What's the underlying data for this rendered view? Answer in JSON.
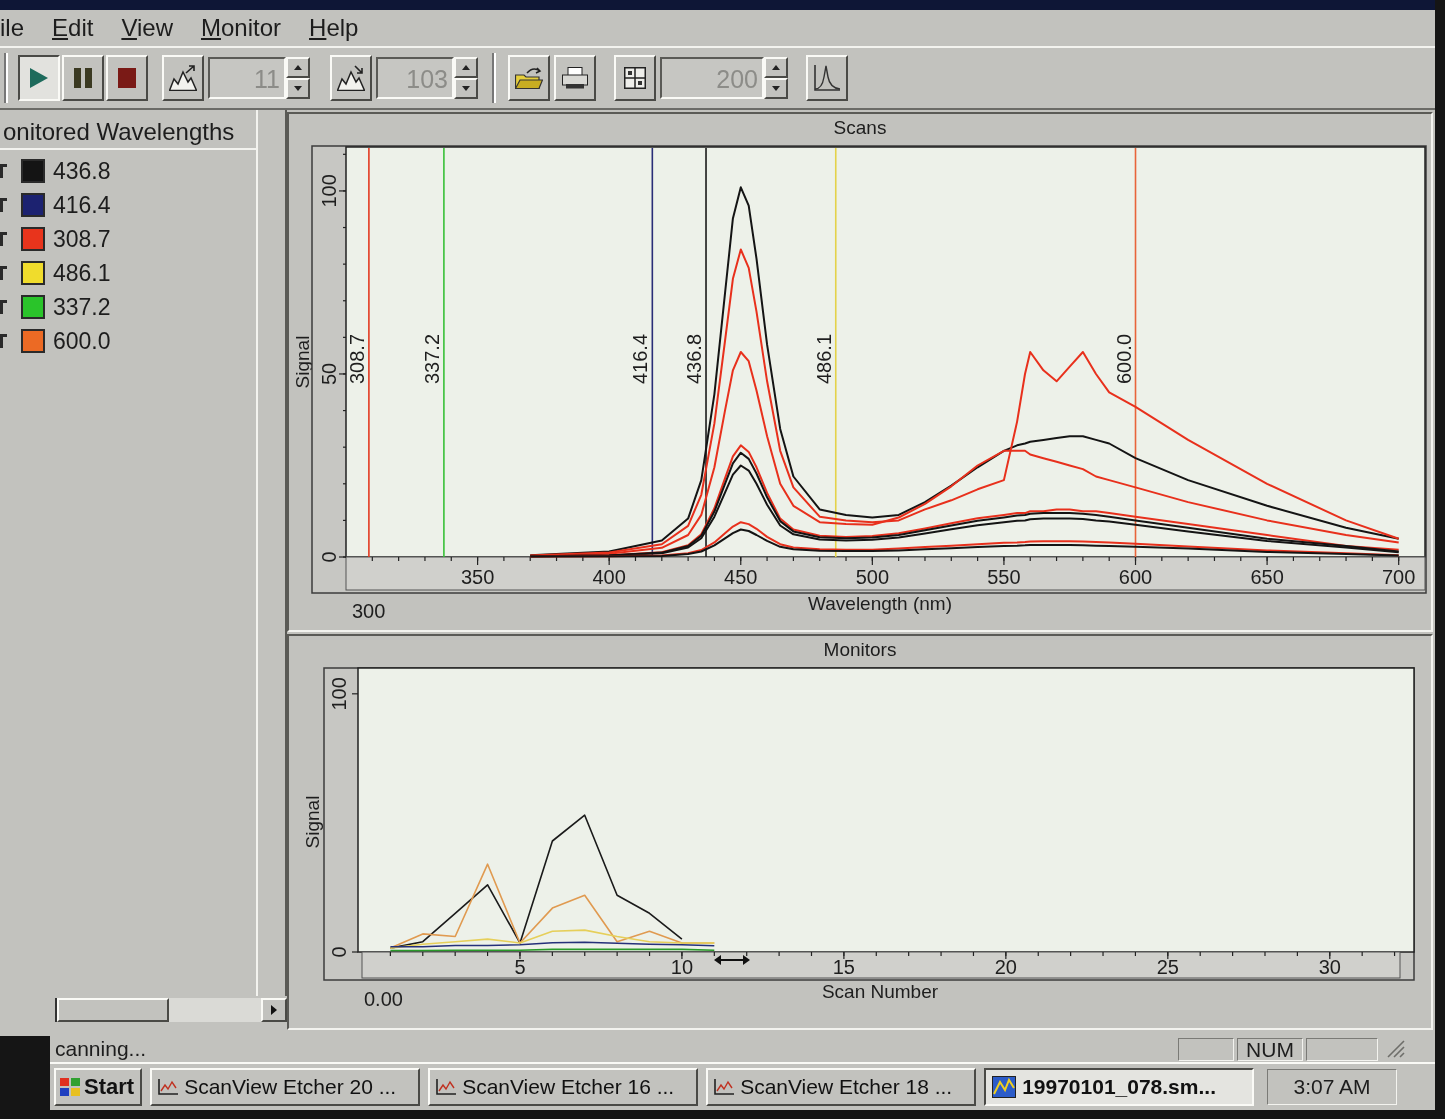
{
  "menu": [
    {
      "label": "ile",
      "underline_first": false
    },
    {
      "label": "Edit",
      "underline_first": true
    },
    {
      "label": "View",
      "underline_first": true
    },
    {
      "label": "Monitor",
      "underline_first": true
    },
    {
      "label": "Help",
      "underline_first": true
    }
  ],
  "toolbar": {
    "transport": [
      {
        "kind": "play",
        "selected": true
      },
      {
        "kind": "pause",
        "selected": false
      },
      {
        "kind": "stop",
        "selected": false
      }
    ],
    "groups": [
      [
        {
          "kind": "peaks-up"
        },
        {
          "kind": "spin",
          "value": "11",
          "disabled": true
        },
        {
          "kind": "peaks-down"
        },
        {
          "kind": "spin",
          "value": "103",
          "disabled": true
        }
      ],
      [
        {
          "kind": "open"
        },
        {
          "kind": "print"
        },
        {
          "kind": "grid"
        },
        {
          "kind": "spin",
          "value": "200",
          "disabled": true
        },
        {
          "kind": "spectrum"
        }
      ]
    ]
  },
  "wavelength_panel": {
    "title": "onitored Wavelengths",
    "items": [
      {
        "label": "436.8",
        "color": "#141414"
      },
      {
        "label": "416.4",
        "color": "#1c2270"
      },
      {
        "label": "308.7",
        "color": "#e8341c"
      },
      {
        "label": "486.1",
        "color": "#f0dc2c"
      },
      {
        "label": "337.2",
        "color": "#2ac42a"
      },
      {
        "label": "600.0",
        "color": "#ec6a24"
      }
    ]
  },
  "scans": {
    "x_start_label": "300",
    "chart_data": {
      "type": "line",
      "title": "Scans",
      "xlabel": "Wavelength (nm)",
      "ylabel": "Signal",
      "x": [
        370,
        400,
        420,
        430,
        435,
        440,
        444,
        447,
        450,
        453,
        456,
        460,
        465,
        470,
        480,
        490,
        500,
        510,
        520,
        530,
        540,
        550,
        555,
        558,
        560,
        565,
        570,
        575,
        580,
        585,
        590,
        600,
        620,
        650,
        680,
        700
      ],
      "series": [
        {
          "color": "#141414",
          "values": [
            0.5,
            1.5,
            4.5,
            10.5,
            21,
            44.5,
            72,
            92.5,
            101,
            96,
            81.5,
            58,
            35,
            22,
            13,
            11.5,
            10.8,
            11.5,
            15,
            19.5,
            24.5,
            29,
            30.5,
            31,
            31.5,
            32,
            32.5,
            33,
            33,
            32,
            31,
            27,
            21,
            14,
            8,
            5
          ]
        },
        {
          "color": "#e8301c",
          "values": [
            0.4,
            1.2,
            3.5,
            8.5,
            17,
            36.5,
            59,
            76,
            84,
            79,
            67,
            48,
            29,
            19,
            11,
            10,
            9.5,
            10,
            13,
            15.5,
            18.5,
            21,
            37,
            50,
            56,
            51,
            48,
            52,
            56,
            50,
            45,
            41,
            32,
            20,
            10,
            5
          ]
        },
        {
          "color": "#e8301c",
          "values": [
            0.3,
            0.9,
            2.5,
            6,
            11.5,
            24.5,
            40,
            51,
            56,
            53.5,
            45.5,
            33,
            20,
            14,
            9.5,
            9,
            8.8,
            10.8,
            14.5,
            19.3,
            25,
            29,
            29,
            29,
            28,
            27,
            26,
            25,
            24,
            22,
            21,
            19,
            15,
            10,
            6,
            4
          ]
        },
        {
          "color": "#e8301c",
          "values": [
            0.2,
            0.5,
            1.3,
            3.2,
            6.2,
            13.3,
            21.5,
            27.5,
            30.5,
            28.7,
            24.5,
            17.5,
            10.5,
            7.5,
            5.8,
            5.5,
            5.7,
            6.5,
            7.8,
            9.2,
            10.6,
            11.5,
            12,
            12,
            12.5,
            12.5,
            13,
            13,
            12.5,
            12.5,
            12,
            11,
            9,
            6,
            3,
            2
          ]
        },
        {
          "color": "#141414",
          "values": [
            0.2,
            0.4,
            1.2,
            3,
            5.8,
            12.4,
            20,
            25.6,
            28.5,
            26.8,
            22.8,
            16.3,
            9.8,
            7,
            5.4,
            5.1,
            5.3,
            6,
            7.3,
            8.6,
            9.9,
            10.8,
            11.3,
            11.5,
            11.8,
            12,
            12,
            12,
            11.8,
            11.5,
            11,
            10,
            8,
            5,
            3,
            1.5
          ]
        },
        {
          "color": "#141414",
          "values": [
            0.2,
            0.4,
            1,
            2.6,
            5.1,
            11,
            17.6,
            22.5,
            25,
            23.6,
            20,
            14.3,
            8.6,
            6.2,
            4.8,
            4.5,
            4.7,
            5.3,
            6.4,
            7.6,
            8.7,
            9.5,
            9.9,
            10,
            10.3,
            10.5,
            10.5,
            10.5,
            10.4,
            10,
            9.7,
            8.8,
            7,
            4.4,
            2.6,
            1.3
          ]
        },
        {
          "color": "#e8301c",
          "values": [
            0.1,
            0.2,
            0.4,
            1,
            1.9,
            4,
            6.5,
            8.3,
            9.5,
            9,
            7.7,
            5.5,
            3.5,
            2.6,
            2.1,
            2,
            2,
            2.3,
            2.7,
            3.1,
            3.5,
            3.9,
            4,
            4.1,
            4.2,
            4.3,
            4.3,
            4.3,
            4.2,
            4.1,
            4,
            3.6,
            2.9,
            1.8,
            1,
            0.5
          ]
        },
        {
          "color": "#141414",
          "values": [
            0.1,
            0.2,
            0.3,
            0.8,
            1.5,
            3.2,
            5.1,
            6.5,
            7.5,
            7.1,
            6,
            4.4,
            2.8,
            2.1,
            1.7,
            1.6,
            1.6,
            1.8,
            2.1,
            2.4,
            2.7,
            3,
            3.1,
            3.2,
            3.3,
            3.3,
            3.3,
            3.3,
            3.2,
            3.1,
            3,
            2.8,
            2.3,
            1.4,
            0.8,
            0.4
          ]
        }
      ],
      "xlim": [
        300,
        710
      ],
      "ylim": [
        0,
        112
      ],
      "xticks": [
        350,
        400,
        450,
        500,
        550,
        600,
        650,
        700
      ],
      "yticks": [
        0,
        50,
        100
      ],
      "ref_lines": [
        {
          "axis": "x",
          "value": 308.7,
          "label": "308.7",
          "color": "#e23a22"
        },
        {
          "axis": "x",
          "value": 337.2,
          "label": "337.2",
          "color": "#38c038"
        },
        {
          "axis": "x",
          "value": 416.4,
          "label": "416.4",
          "color": "#2a2e78"
        },
        {
          "axis": "x",
          "value": 436.8,
          "label": "436.8",
          "color": "#1a1a1a"
        },
        {
          "axis": "x",
          "value": 486.1,
          "label": "486.1",
          "color": "#e4d24a"
        },
        {
          "axis": "x",
          "value": 600.0,
          "label": "600.0",
          "color": "#e8643a"
        }
      ]
    }
  },
  "monitors": {
    "x_start_label": "0.00",
    "chart_data": {
      "type": "line",
      "title": "Monitors",
      "xlabel": "Scan Number",
      "ylabel": "Signal",
      "x": [
        1,
        2,
        3,
        4,
        5,
        6,
        7,
        8,
        9,
        10,
        11
      ],
      "series": [
        {
          "color": "#1a1a1a",
          "values": [
            1.5,
            4,
            15,
            26,
            3.5,
            43,
            53,
            22,
            15,
            5,
            null
          ]
        },
        {
          "color": "#e09a50",
          "values": [
            1.5,
            7,
            6,
            34,
            3.5,
            17,
            22,
            4,
            8,
            3.5,
            3.5
          ]
        },
        {
          "color": "#e6cf5a",
          "values": [
            1.5,
            3,
            4,
            5,
            3.5,
            8,
            8.5,
            6,
            4,
            3.5,
            3.5
          ]
        },
        {
          "color": "#25307a",
          "values": [
            2,
            2,
            2.5,
            2.5,
            2.8,
            3.6,
            3.8,
            3.4,
            3,
            2.8,
            2.4
          ]
        },
        {
          "color": "#2a9a2a",
          "values": [
            0.6,
            0.6,
            0.7,
            0.7,
            0.7,
            1,
            1,
            1,
            1,
            1,
            0.7
          ]
        }
      ],
      "xlim": [
        0,
        32.6
      ],
      "ylim": [
        0,
        110
      ],
      "xticks": [
        5,
        10,
        15,
        20,
        25,
        30
      ],
      "yticks": [
        0,
        100
      ]
    }
  },
  "status_bar": {
    "message": "canning...",
    "indicator": "NUM"
  },
  "taskbar": {
    "start": "Start",
    "tasks": [
      {
        "kind": "app",
        "label": "ScanView Etcher 20 ...",
        "selected": false
      },
      {
        "kind": "app",
        "label": "ScanView Etcher 16 ...",
        "selected": false
      },
      {
        "kind": "app",
        "label": "ScanView Etcher 18 ...",
        "selected": false
      },
      {
        "kind": "document",
        "label": "19970101_078.sm...",
        "selected": true
      }
    ],
    "clock": "3:07 AM"
  }
}
